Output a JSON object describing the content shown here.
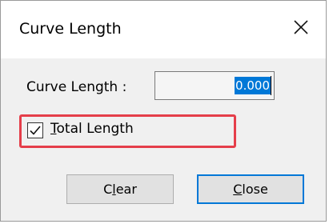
{
  "window": {
    "title": "Curve Length"
  },
  "form": {
    "curve_length_label": "Curve Length :",
    "curve_length_value": "0.000",
    "total_length_checkbox": {
      "mnemonic": "T",
      "label_rest": "otal Length",
      "checked": true
    }
  },
  "buttons": {
    "clear": {
      "pre": "C",
      "mnemonic": "l",
      "post": "ear"
    },
    "close": {
      "pre": "",
      "mnemonic": "C",
      "post": "lose"
    }
  },
  "colors": {
    "highlight_border": "#e53e4a",
    "selection": "#0078d7",
    "default_button_border": "#0078d7"
  },
  "icons": {
    "close": "close-icon",
    "checkbox_check": "checkmark-icon"
  }
}
